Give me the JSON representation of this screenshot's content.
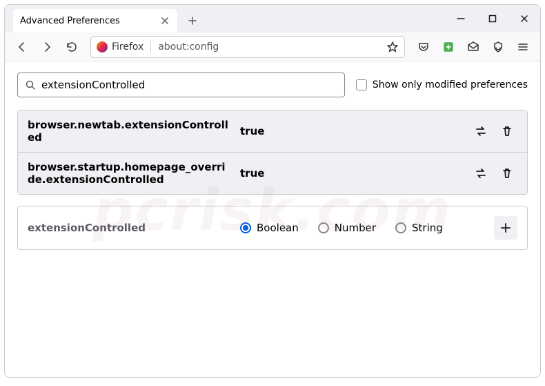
{
  "tab": {
    "title": "Advanced Preferences"
  },
  "address_bar": {
    "app_label": "Firefox",
    "url": "about:config"
  },
  "search": {
    "value": "extensionControlled",
    "checkbox_label": "Show only modified preferences"
  },
  "results": [
    {
      "name": "browser.newtab.extensionControlled",
      "value": "true"
    },
    {
      "name": "browser.startup.homepage_override.extensionControlled",
      "value": "true"
    }
  ],
  "new_pref": {
    "name": "extensionControlled",
    "types": [
      "Boolean",
      "Number",
      "String"
    ],
    "selected": "Boolean"
  },
  "watermark": "pcrisk.com"
}
